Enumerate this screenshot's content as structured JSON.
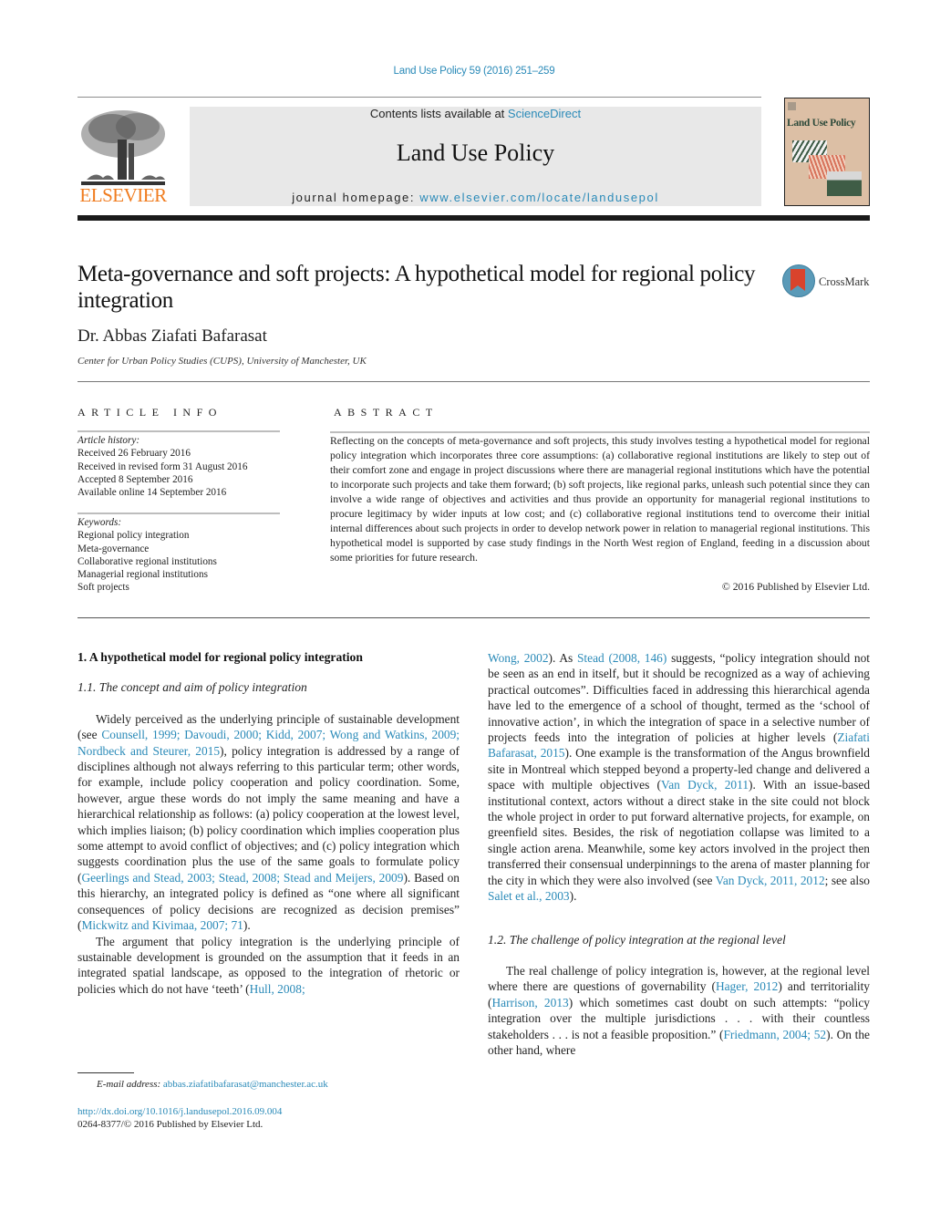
{
  "header": {
    "citation": "Land Use Policy 59 (2016) 251–259",
    "contents_prefix": "Contents lists available at ",
    "contents_link": "ScienceDirect",
    "journal_title": "Land Use Policy",
    "homepage_prefix": "journal homepage: ",
    "homepage_link": "www.elsevier.com/locate/landusepol",
    "publisher_logo_text": "ELSEVIER",
    "cover_title": "Land Use Policy",
    "crossmark_label": "CrossMark",
    "colors": {
      "link": "#2a8ab8",
      "elsevier_orange": "#f07c1f",
      "masthead_bg": "#e8e8e8",
      "cover_bg": "#dcbfa5"
    }
  },
  "article": {
    "title": "Meta-governance and soft projects: A hypothetical model for regional policy integration",
    "author": "Dr. Abbas Ziafati Bafarasat",
    "affiliation": "Center for Urban Policy Studies (CUPS), University of Manchester, UK"
  },
  "article_info": {
    "heading": "ARTICLE INFO",
    "history_label": "Article history:",
    "history": [
      "Received 26 February 2016",
      "Received in revised form 31 August 2016",
      "Accepted 8 September 2016",
      "Available online 14 September 2016"
    ],
    "keywords_label": "Keywords:",
    "keywords": [
      "Regional policy integration",
      "Meta-governance",
      "Collaborative regional institutions",
      "Managerial regional institutions",
      "Soft projects"
    ]
  },
  "abstract": {
    "heading": "ABSTRACT",
    "text": "Reflecting on the concepts of meta-governance and soft projects, this study involves testing a hypothetical model for regional policy integration which incorporates three core assumptions: (a) collaborative regional institutions are likely to step out of their comfort zone and engage in project discussions where there are managerial regional institutions which have the potential to incorporate such projects and take them forward; (b) soft projects, like regional parks, unleash such potential since they can involve a wide range of objectives and activities and thus provide an opportunity for managerial regional institutions to procure legitimacy by wider inputs at low cost; and (c) collaborative regional institutions tend to overcome their initial internal differences about such projects in order to develop network power in relation to managerial regional institutions. This hypothetical model is supported by case study findings in the North West region of England, feeding in a discussion about some priorities for future research.",
    "copyright": "© 2016 Published by Elsevier Ltd."
  },
  "body": {
    "section1_heading": "1.  A hypothetical model for regional policy integration",
    "subsection11_heading": "1.1.  The concept and aim of policy integration",
    "p1": [
      {
        "t": "Widely perceived as the underlying principle of sustainable development (see "
      },
      {
        "t": "Counsell, 1999; Davoudi, 2000; Kidd, 2007; Wong and Watkins, 2009; Nordbeck and Steurer, 2015",
        "link": true
      },
      {
        "t": "), policy integration is addressed by a range of disciplines although not always referring to this particular term; other words, for example, include policy cooperation and policy coordination. Some, however, argue these words do not imply the same meaning and have a hierarchical relationship as follows: (a) policy cooperation at the lowest level, which implies liaison; (b) policy coordination which implies cooperation plus some attempt to avoid conflict of objectives; and (c) policy integration which suggests coordination plus the use of the same goals to formulate policy ("
      },
      {
        "t": "Geerlings and Stead, 2003; Stead, 2008; Stead and Meijers, 2009",
        "link": true
      },
      {
        "t": "). Based on this hierarchy, an integrated policy is defined as “one where all significant consequences of policy decisions are recognized as decision premises” ("
      },
      {
        "t": "Mickwitz and Kivimaa, 2007; 71",
        "link": true
      },
      {
        "t": ")."
      }
    ],
    "p2": [
      {
        "t": "The argument that policy integration is the underlying principle of sustainable development is grounded on the assumption that it feeds in an integrated spatial landscape, as opposed to the integration of rhetoric or policies which do not have ‘teeth’ ("
      },
      {
        "t": "Hull, 2008;",
        "link": true
      }
    ],
    "p3": [
      {
        "t": "Wong, 2002",
        "link": true
      },
      {
        "t": "). As "
      },
      {
        "t": "Stead (2008, 146)",
        "link": true
      },
      {
        "t": " suggests, “policy integration should not be seen as an end in itself, but it should be recognized as a way of achieving practical outcomes”. Difficulties faced in addressing this hierarchical agenda have led to the emergence of a school of thought, termed as the ‘school of innovative action’, in which the integration of space in a selective number of projects feeds into the integration of policies at higher levels ("
      },
      {
        "t": "Ziafati Bafarasat, 2015",
        "link": true
      },
      {
        "t": "). One example is the transformation of the Angus brownfield site in Montreal which stepped beyond a property-led change and delivered a space with multiple objectives ("
      },
      {
        "t": "Van Dyck, 2011",
        "link": true
      },
      {
        "t": "). With an issue-based institutional context, actors without a direct stake in the site could not block the whole project in order to put forward alternative projects, for example, on greenfield sites. Besides, the risk of negotiation collapse was limited to a single action arena. Meanwhile, some key actors involved in the project then transferred their consensual underpinnings to the arena of master planning for the city in which they were also involved (see "
      },
      {
        "t": "Van Dyck, 2011, 2012",
        "link": true
      },
      {
        "t": "; see also "
      },
      {
        "t": "Salet et al., 2003",
        "link": true
      },
      {
        "t": ")."
      }
    ],
    "subsection12_heading": "1.2.  The challenge of policy integration at the regional level",
    "p4": [
      {
        "t": "The real challenge of policy integration is, however, at the regional level where there are questions of governability ("
      },
      {
        "t": "Hager, 2012",
        "link": true
      },
      {
        "t": ") and territoriality ("
      },
      {
        "t": "Harrison, 2013",
        "link": true
      },
      {
        "t": ") which sometimes cast doubt on such attempts: “policy integration over the multiple jurisdictions . . . with their countless stakeholders . . . is not a feasible proposition.” ("
      },
      {
        "t": "Friedmann, 2004; 52",
        "link": true
      },
      {
        "t": "). On the other hand, where"
      }
    ]
  },
  "footer": {
    "email_label": "E-mail address: ",
    "email": "abbas.ziafatibafarasat@manchester.ac.uk",
    "doi": "http://dx.doi.org/10.1016/j.landusepol.2016.09.004",
    "issn_line": "0264-8377/© 2016 Published by Elsevier Ltd."
  }
}
